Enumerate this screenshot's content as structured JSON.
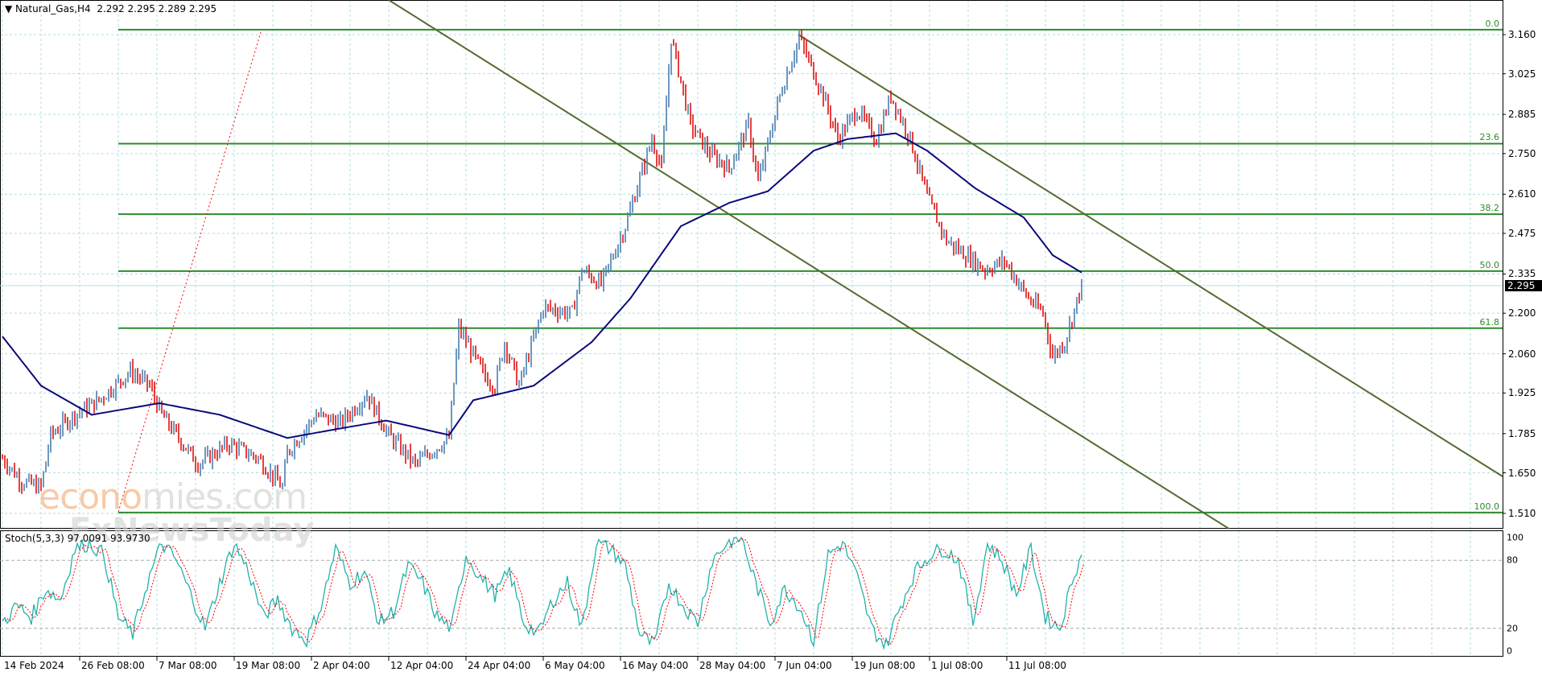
{
  "header": {
    "symbol": "Natural_Gas,H4",
    "ohlc": "2.292 2.295 2.289 2.295"
  },
  "stoch_label": "Stoch(5,3,3) 97.0091 93.9730",
  "watermark": {
    "logo1_a": "econo",
    "logo1_b": "mies.com",
    "logo2": "FxNewsToday"
  },
  "colors": {
    "up": "#4a7fb0",
    "down": "#e01010",
    "ma": "#0a0a7a",
    "fib": "#2e8b2e",
    "channel": "#556b2f",
    "stoch_k": "#20b2aa",
    "stoch_d": "#ff0000",
    "grid": "#b0dde0"
  },
  "price_axis": [
    "3.160",
    "3.025",
    "2.885",
    "2.750",
    "2.610",
    "2.475",
    "2.335",
    "2.200",
    "2.060",
    "1.925",
    "1.785",
    "1.650",
    "1.510"
  ],
  "current_price": "2.295",
  "fib_levels": [
    {
      "label": "0.0",
      "pct": 0
    },
    {
      "label": "23.6",
      "pct": 23.6
    },
    {
      "label": "38.2",
      "pct": 38.2
    },
    {
      "label": "50.0",
      "pct": 50
    },
    {
      "label": "61.8",
      "pct": 61.8
    },
    {
      "label": "100.0",
      "pct": 100
    }
  ],
  "stoch_axis": [
    "100",
    "80",
    "20",
    "0"
  ],
  "date_axis": [
    "14 Feb 2024",
    "26 Feb 08:00",
    "7 Mar 08:00",
    "19 Mar 08:00",
    "2 Apr 04:00",
    "12 Apr 04:00",
    "24 Apr 04:00",
    "6 May 04:00",
    "16 May 04:00",
    "28 May 04:00",
    "7 Jun 04:00",
    "19 Jun 08:00",
    "1 Jul 08:00",
    "11 Jul 08:00"
  ],
  "chart_data": {
    "type": "candlestick",
    "title": "Natural_Gas,H4",
    "ylim": [
      1.45,
      3.28
    ],
    "fib_high": 3.177,
    "fib_low": 1.513,
    "price_path": [
      [
        0,
        1.7
      ],
      [
        8,
        1.62
      ],
      [
        16,
        1.6
      ],
      [
        20,
        1.78
      ],
      [
        30,
        1.85
      ],
      [
        40,
        1.9
      ],
      [
        53,
        2.0
      ],
      [
        61,
        1.95
      ],
      [
        66,
        1.85
      ],
      [
        81,
        1.68
      ],
      [
        94,
        1.75
      ],
      [
        106,
        1.7
      ],
      [
        116,
        1.6
      ],
      [
        118,
        1.72
      ],
      [
        130,
        1.85
      ],
      [
        140,
        1.82
      ],
      [
        151,
        1.92
      ],
      [
        160,
        1.78
      ],
      [
        171,
        1.68
      ],
      [
        185,
        1.77
      ],
      [
        189,
        2.15
      ],
      [
        200,
        1.98
      ],
      [
        204,
        1.95
      ],
      [
        208,
        2.1
      ],
      [
        214,
        1.95
      ],
      [
        224,
        2.22
      ],
      [
        236,
        2.2
      ],
      [
        240,
        2.35
      ],
      [
        248,
        2.3
      ],
      [
        258,
        2.5
      ],
      [
        269,
        2.8
      ],
      [
        273,
        2.7
      ],
      [
        277,
        3.15
      ],
      [
        285,
        2.85
      ],
      [
        293,
        2.75
      ],
      [
        301,
        2.7
      ],
      [
        309,
        2.85
      ],
      [
        313,
        2.65
      ],
      [
        322,
        2.95
      ],
      [
        330,
        3.15
      ],
      [
        340,
        2.95
      ],
      [
        346,
        2.8
      ],
      [
        354,
        2.9
      ],
      [
        362,
        2.8
      ],
      [
        368,
        2.95
      ],
      [
        376,
        2.8
      ],
      [
        383,
        2.6
      ],
      [
        391,
        2.45
      ],
      [
        399,
        2.4
      ],
      [
        407,
        2.35
      ],
      [
        415,
        2.38
      ],
      [
        425,
        2.25
      ],
      [
        431,
        2.2
      ],
      [
        435,
        2.05
      ],
      [
        440,
        2.1
      ],
      [
        447,
        2.295
      ]
    ],
    "ma_path": [
      [
        0,
        2.12
      ],
      [
        16,
        1.95
      ],
      [
        37,
        1.85
      ],
      [
        65,
        1.89
      ],
      [
        90,
        1.85
      ],
      [
        118,
        1.77
      ],
      [
        138,
        1.8
      ],
      [
        159,
        1.83
      ],
      [
        185,
        1.78
      ],
      [
        195,
        1.9
      ],
      [
        220,
        1.95
      ],
      [
        244,
        2.1
      ],
      [
        260,
        2.25
      ],
      [
        281,
        2.5
      ],
      [
        301,
        2.58
      ],
      [
        317,
        2.62
      ],
      [
        336,
        2.76
      ],
      [
        350,
        2.8
      ],
      [
        370,
        2.82
      ],
      [
        383,
        2.76
      ],
      [
        403,
        2.63
      ],
      [
        423,
        2.53
      ],
      [
        435,
        2.4
      ],
      [
        447,
        2.34
      ]
    ],
    "stoch_k_every6": [
      25,
      40,
      30,
      55,
      45,
      90,
      95,
      85,
      30,
      15,
      60,
      95,
      80,
      50,
      20,
      60,
      95,
      70,
      30,
      45,
      20,
      10,
      40,
      90,
      60,
      70,
      25,
      35,
      75,
      60,
      30,
      20,
      85,
      65,
      50,
      70,
      25,
      15,
      45,
      60,
      20,
      95,
      90,
      75,
      15,
      5,
      60,
      40,
      25,
      80,
      95,
      100,
      60,
      25,
      55,
      40,
      10,
      85,
      95,
      65,
      20,
      5,
      40,
      70,
      85,
      90,
      80,
      25,
      95,
      80,
      50,
      90,
      30,
      20,
      70,
      97
    ]
  }
}
